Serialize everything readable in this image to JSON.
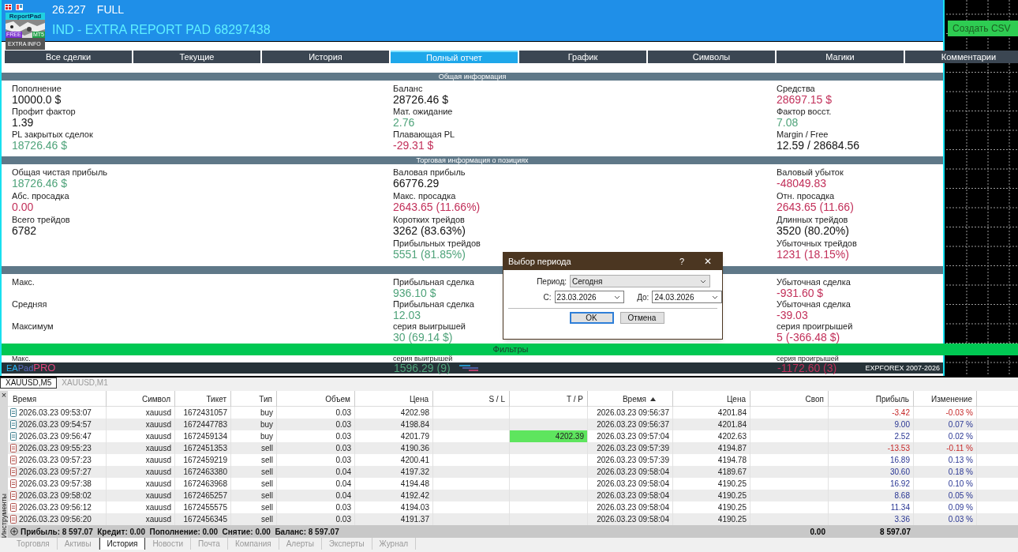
{
  "header": {
    "version": "26.227",
    "edition": "FULL",
    "title": "IND - EXTRA REPORT PAD 68297438"
  },
  "logo": {
    "name": "ReportPad",
    "badge_left": "FREE",
    "badge_right": "MT5",
    "caption": "EXTRA INFO"
  },
  "csv_button": "Создать CSV",
  "tabs": [
    {
      "label": "Все сделки",
      "selected": false
    },
    {
      "label": "Текущие",
      "selected": false
    },
    {
      "label": "История",
      "selected": false
    },
    {
      "label": "Полный отчет",
      "selected": true
    },
    {
      "label": "График",
      "selected": false
    },
    {
      "label": "Символы",
      "selected": false
    },
    {
      "label": "Магики",
      "selected": false
    },
    {
      "label": "Комментарии",
      "selected": false
    }
  ],
  "sections": [
    {
      "title": "Общая информация",
      "columns": [
        [
          {
            "label": "Пополнение",
            "value": "10000.0 $",
            "color": "#111111"
          },
          {
            "label": "Профит фактор",
            "value": "1.39",
            "color": "#111111"
          },
          {
            "label": "PL закрытых сделок",
            "value": "18726.46 $",
            "color": "#4fa37a"
          }
        ],
        [
          {
            "label": "Баланс",
            "value": "28726.46 $",
            "color": "#111111"
          },
          {
            "label": "Мат. ожидание",
            "value": "2.76",
            "color": "#4fa37a"
          },
          {
            "label": "Плавающая PL",
            "value": "-29.31 $",
            "color": "#c2305a"
          }
        ],
        [
          {
            "label": "Средства",
            "value": "28697.15 $",
            "color": "#c2305a"
          },
          {
            "label": "Фактор восст.",
            "value": "7.08",
            "color": "#4fa37a"
          },
          {
            "label": "Margin / Free",
            "value": "12.59 / 28684.56",
            "color": "#111111"
          }
        ]
      ]
    },
    {
      "title": "Торговая информация о позициях",
      "columns": [
        [
          {
            "label": "Общая чистая прибыль",
            "value": "18726.46 $",
            "color": "#4fa37a"
          },
          {
            "label": "Абс. просадка",
            "value": "0.00",
            "color": "#c2305a"
          },
          {
            "label": "Всего трейдов",
            "value": "6782",
            "color": "#111111"
          }
        ],
        [
          {
            "label": "Валовая прибыль",
            "value": "66776.29",
            "color": "#111111"
          },
          {
            "label": "Макс. просадка",
            "value": "2643.65 (11.66%)",
            "color": "#c2305a"
          },
          {
            "label": "Коротких трейдов",
            "value": "3262 (83.63%)",
            "color": "#111111"
          },
          {
            "label": "Прибыльных трейдов",
            "value": "5551 (81.85%)",
            "color": "#4fa37a"
          }
        ],
        [
          {
            "label": "Валовый убыток",
            "value": "-48049.83",
            "color": "#c2305a"
          },
          {
            "label": "Отн. просадка",
            "value": "2643.65 (11.66)",
            "color": "#c2305a"
          },
          {
            "label": "Длинных трейдов",
            "value": "3520 (80.20%)",
            "color": "#111111"
          },
          {
            "label": "Убыточных трейдов",
            "value": "1231 (18.15%)",
            "color": "#c2305a"
          }
        ]
      ]
    },
    {
      "columns": [
        [
          {
            "label": "Макс."
          },
          {
            "label": "Средняя"
          },
          {
            "label": "Максимум"
          }
        ],
        [
          {
            "label": "Прибыльная сделка",
            "value": "936.10 $",
            "color": "#4fa37a"
          },
          {
            "label": "Прибыльная сделка",
            "value": "12.03",
            "color": "#4fa37a"
          },
          {
            "label": "серия выигрышей",
            "value": "30 (69.14 $)",
            "color": "#4fa37a"
          }
        ],
        [
          {
            "label": "Убыточная сделка",
            "value": "-931.60 $",
            "color": "#c2305a"
          },
          {
            "label": "Убыточная сделка",
            "value": "-39.03",
            "color": "#c2305a"
          },
          {
            "label": "серия проигрышей",
            "value": "5 (-366.48 $)",
            "color": "#c2305a"
          }
        ]
      ]
    }
  ],
  "filter_bar": "Фильтры",
  "footer": {
    "labels": [
      "Макс.",
      "серия выигрышей",
      "серия проигрышей"
    ],
    "brand": [
      "EA",
      "Pad",
      "PRO"
    ],
    "values": [
      {
        "value": "1596.29 (9)",
        "loss": false
      },
      {
        "value": "-1172.60 (3)",
        "loss": true
      }
    ],
    "copyright": "EXPFOREX 2007-2026"
  },
  "dialog": {
    "title": "Выбор периода",
    "help": "?",
    "close": "✕",
    "period_label": "Период:",
    "period_value": "Сегодня",
    "from_label": "С:",
    "from_value": "23.03.2026",
    "to_label": "До:",
    "to_value": "24.03.2026",
    "buttons": [
      {
        "label": "OK",
        "default": true
      },
      {
        "label": "Отмена",
        "default": false
      }
    ]
  },
  "terminal": {
    "chart_tabs": [
      {
        "label": "XAUUSD,M5",
        "selected": true
      },
      {
        "label": "XAUUSD,M1",
        "selected": false
      }
    ],
    "side_label": "Инструменты",
    "close": "×",
    "columns": [
      {
        "label": "Время",
        "sorted": false
      },
      {
        "label": "Символ",
        "sorted": false
      },
      {
        "label": "Тикет",
        "sorted": false
      },
      {
        "label": "Тип",
        "sorted": false
      },
      {
        "label": "Объем",
        "sorted": false
      },
      {
        "label": "Цена",
        "sorted": false
      },
      {
        "label": "S / L",
        "sorted": false
      },
      {
        "label": "T / P",
        "sorted": false
      },
      {
        "label": "Время",
        "sorted": true
      },
      {
        "label": "Цена",
        "sorted": false
      },
      {
        "label": "Своп",
        "sorted": false
      },
      {
        "label": "Прибыль",
        "sorted": false
      },
      {
        "label": "Изменение",
        "sorted": false
      }
    ],
    "rows": [
      {
        "kind": "buy",
        "time": "2026.03.23 09:53:07",
        "symbol": "xauusd",
        "ticket": "1672431057",
        "type": "buy",
        "volume": "0.03",
        "price": "4202.98",
        "close_time": "2026.03.23 09:56:37",
        "close_price": "4201.84",
        "profit": "-3.42",
        "change": "-0.03 %",
        "loss": true
      },
      {
        "kind": "buy",
        "time": "2026.03.23 09:54:57",
        "symbol": "xauusd",
        "ticket": "1672447783",
        "type": "buy",
        "volume": "0.03",
        "price": "4198.84",
        "close_time": "2026.03.23 09:56:37",
        "close_price": "4201.84",
        "profit": "9.00",
        "change": "0.07 %",
        "loss": false
      },
      {
        "kind": "buy",
        "time": "2026.03.23 09:56:47",
        "symbol": "xauusd",
        "ticket": "1672459134",
        "type": "buy",
        "volume": "0.03",
        "price": "4201.79",
        "tp": "4202.39",
        "close_time": "2026.03.23 09:57:04",
        "close_price": "4202.63",
        "profit": "2.52",
        "change": "0.02 %",
        "loss": false
      },
      {
        "kind": "sell",
        "time": "2026.03.23 09:55:23",
        "symbol": "xauusd",
        "ticket": "1672451353",
        "type": "sell",
        "volume": "0.03",
        "price": "4190.36",
        "close_time": "2026.03.23 09:57:39",
        "close_price": "4194.87",
        "profit": "-13.53",
        "change": "-0.11 %",
        "loss": true
      },
      {
        "kind": "sell",
        "time": "2026.03.23 09:57:23",
        "symbol": "xauusd",
        "ticket": "1672459219",
        "type": "sell",
        "volume": "0.03",
        "price": "4200.41",
        "close_time": "2026.03.23 09:57:39",
        "close_price": "4194.78",
        "profit": "16.89",
        "change": "0.13 %",
        "loss": false
      },
      {
        "kind": "sell",
        "time": "2026.03.23 09:57:27",
        "symbol": "xauusd",
        "ticket": "1672463380",
        "type": "sell",
        "volume": "0.04",
        "price": "4197.32",
        "close_time": "2026.03.23 09:58:04",
        "close_price": "4189.67",
        "profit": "30.60",
        "change": "0.18 %",
        "loss": false
      },
      {
        "kind": "sell",
        "time": "2026.03.23 09:57:38",
        "symbol": "xauusd",
        "ticket": "1672463968",
        "type": "sell",
        "volume": "0.04",
        "price": "4194.48",
        "close_time": "2026.03.23 09:58:04",
        "close_price": "4190.25",
        "profit": "16.92",
        "change": "0.10 %",
        "loss": false
      },
      {
        "kind": "sell",
        "time": "2026.03.23 09:58:02",
        "symbol": "xauusd",
        "ticket": "1672465257",
        "type": "sell",
        "volume": "0.04",
        "price": "4192.42",
        "close_time": "2026.03.23 09:58:04",
        "close_price": "4190.25",
        "profit": "8.68",
        "change": "0.05 %",
        "loss": false
      },
      {
        "kind": "sell",
        "time": "2026.03.23 09:56:12",
        "symbol": "xauusd",
        "ticket": "1672455575",
        "type": "sell",
        "volume": "0.03",
        "price": "4194.03",
        "close_time": "2026.03.23 09:58:04",
        "close_price": "4190.25",
        "profit": "11.34",
        "change": "0.09 %",
        "loss": false
      },
      {
        "kind": "sell",
        "time": "2026.03.23 09:56:20",
        "symbol": "xauusd",
        "ticket": "1672456345",
        "type": "sell",
        "volume": "0.03",
        "price": "4191.37",
        "close_time": "2026.03.23 09:58:04",
        "close_price": "4190.25",
        "profit": "3.36",
        "change": "0.03 %",
        "loss": false
      }
    ],
    "summary": {
      "text": "Прибыль: 8 597.07  Кредит: 0.00  Пополнение: 0.00  Снятие: 0.00  Баланс: 8 597.07",
      "swap": "0.00",
      "profit": "8 597.07"
    },
    "bottom_tabs": [
      {
        "label": "Торговля",
        "selected": false
      },
      {
        "label": "Активы",
        "selected": false
      },
      {
        "label": "История",
        "selected": true
      },
      {
        "label": "Новости",
        "selected": false
      },
      {
        "label": "Почта",
        "selected": false
      },
      {
        "label": "Компания",
        "selected": false
      },
      {
        "label": "Алерты",
        "selected": false
      },
      {
        "label": "Эксперты",
        "selected": false
      },
      {
        "label": "Журнал",
        "selected": false
      }
    ]
  }
}
